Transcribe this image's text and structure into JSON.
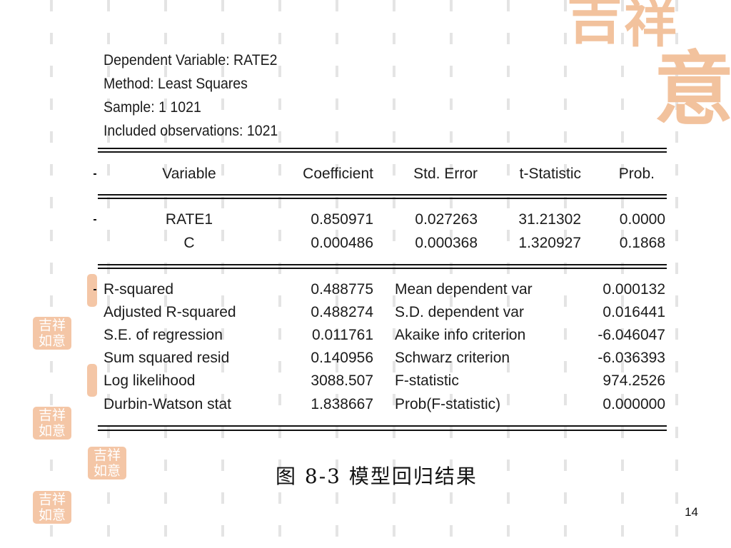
{
  "header": {
    "dependent": "Dependent Variable: RATE2",
    "method": "Method: Least Squares",
    "sample": "Sample: 1 1021",
    "observations": "Included observations: 1021"
  },
  "columns": {
    "variable": "Variable",
    "coefficient": "Coefficient",
    "std_error": "Std. Error",
    "t_statistic": "t-Statistic",
    "prob": "Prob."
  },
  "coefficients": [
    {
      "variable": "RATE1",
      "coefficient": "0.850971",
      "std_error": "0.027263",
      "t_statistic": "31.21302",
      "prob": "0.0000"
    },
    {
      "variable": "C",
      "coefficient": "0.000486",
      "std_error": "0.000368",
      "t_statistic": "1.320927",
      "prob": "0.1868"
    }
  ],
  "stats": [
    {
      "label": "R-squared",
      "value": "0.488775",
      "label2": "Mean dependent var",
      "value2": "0.000132"
    },
    {
      "label": "Adjusted R-squared",
      "value": "0.488274",
      "label2": "S.D. dependent var",
      "value2": "0.016441"
    },
    {
      "label": "S.E. of regression",
      "value": "0.011761",
      "label2": "Akaike info criterion",
      "value2": "-6.046047"
    },
    {
      "label": "Sum squared resid",
      "value": "0.140956",
      "label2": "Schwarz criterion",
      "value2": "-6.036393"
    },
    {
      "label": "Log likelihood",
      "value": "3088.507",
      "label2": "F-statistic",
      "value2": "974.2526"
    },
    {
      "label": "Durbin-Watson stat",
      "value": "1.838667",
      "label2": "Prob(F-statistic)",
      "value2": "0.000000"
    }
  ],
  "caption": "图 8-3 模型回归结果",
  "page_number": "14",
  "decor": {
    "seal_big_glyphs": [
      "吉",
      "祥",
      "意"
    ],
    "seal_small_top": "吉祥",
    "seal_small_bottom": "如意",
    "seal_color": "#f2c29d"
  }
}
